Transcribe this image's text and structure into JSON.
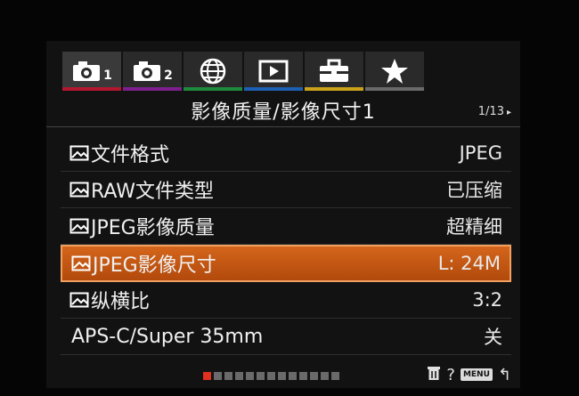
{
  "tabs": [
    {
      "name": "camera-1",
      "num": "1",
      "color": "#b3162f"
    },
    {
      "name": "camera-2",
      "num": "2",
      "color": "#7e1f8e"
    },
    {
      "name": "network",
      "num": "",
      "color": "#1e8a3e"
    },
    {
      "name": "playback",
      "num": "",
      "color": "#1d5fb3"
    },
    {
      "name": "setup",
      "num": "",
      "color": "#c9a21a"
    },
    {
      "name": "my-menu",
      "num": "",
      "color": "#6a6a6a"
    }
  ],
  "header": {
    "title": "影像质量/影像尺寸1",
    "page": "1/13",
    "arrow": "▸"
  },
  "menu": {
    "items": [
      {
        "label": "文件格式",
        "value": "JPEG",
        "icon": "still-image-icon"
      },
      {
        "label": "RAW文件类型",
        "value": "已压缩",
        "icon": "still-image-icon"
      },
      {
        "label": "JPEG影像质量",
        "value": "超精细",
        "icon": "still-image-icon"
      },
      {
        "label": "JPEG影像尺寸",
        "value": "L: 24M",
        "icon": "still-image-icon",
        "selected": true
      },
      {
        "label": "纵横比",
        "value": "3:2",
        "icon": "still-image-icon"
      },
      {
        "label": "APS-C/Super 35mm",
        "value": "关",
        "icon": ""
      }
    ]
  },
  "footer": {
    "page_count": 13,
    "current_page": 1,
    "help": "?",
    "menu_label": "MENU",
    "back_symbol": "↰"
  }
}
